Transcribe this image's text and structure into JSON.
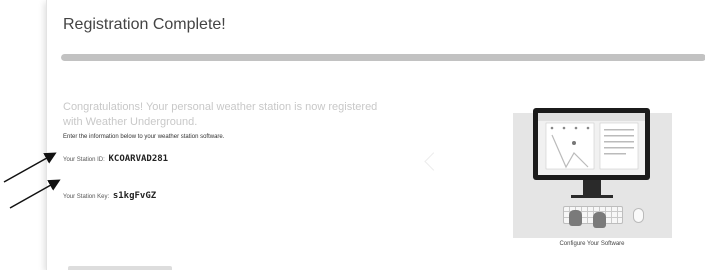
{
  "page": {
    "title": "Registration Complete!",
    "progress_percent": 100
  },
  "message": {
    "congrats": "Congratulations! Your personal weather station is now registered with Weather Underground.",
    "instructions": "Enter the information below to your weather station software."
  },
  "station": {
    "id_label": "Your Station ID:",
    "id_value": "KCOARVAD281",
    "key_label": "Your Station Key:",
    "key_value": "s1kgFvGZ"
  },
  "illustration": {
    "caption": "Configure Your Software",
    "icons": [
      "monitor-icon",
      "keyboard-icon",
      "mouse-icon"
    ]
  },
  "colors": {
    "monitor": "#1b1b1b",
    "illustration_bg": "#e5e5e5",
    "progress_fill": "#c2c2c2"
  }
}
